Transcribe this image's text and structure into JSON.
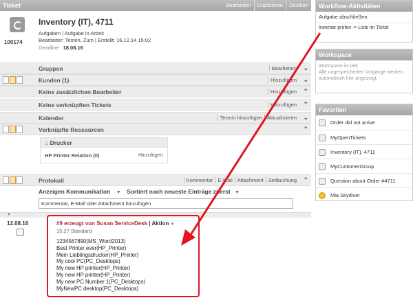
{
  "ticket": {
    "header": "Ticket",
    "actions": [
      "Bearbeiten",
      "Duplizieren",
      "Drucken"
    ],
    "number": "100174",
    "title": "Inventory (IT), 4711",
    "subtitle": "Aufgaben | Aufgabe in Arbeit",
    "bearbeiter": "Bearbeiter: Testen, Zum | Erstellt: 16.12.14 15:02",
    "deadline_label": "Deadline",
    "deadline_value": "18.08.16"
  },
  "sections": {
    "gruppen": {
      "label": "Gruppen",
      "action": "Bearbeiten"
    },
    "kunden": {
      "label": "Kunden (1)",
      "action": "Hinzufügen"
    },
    "bearbeiter": {
      "label": "Keine zusätzlichen Bearbeiter",
      "action": "Hinzufügen"
    },
    "tickets": {
      "label": "Keine verknüpften Tickets",
      "action": "Hinzufügen"
    },
    "kalender": {
      "label": "Kalender",
      "actions": [
        "Termin hinzufügen",
        "Aktualisieren"
      ]
    },
    "ressourcen": {
      "label": "Verknüpfte Ressourcen"
    }
  },
  "drucker": {
    "header": "Drucker",
    "relation": "HP Printer Relation (0)",
    "action": "Hinzufügen"
  },
  "protokoll": {
    "label": "Protokoll",
    "actions": [
      "Kommentar",
      "E-Mail",
      "Attachment",
      "Zeitbuchung"
    ],
    "filter1": "Anzeigen Kommunikation",
    "filter2": "Sortiert nach neueste Einträge zuerst",
    "input_placeholder": "Kommentar, E-Mail oder Attachment hinzufügen"
  },
  "entry": {
    "date": "12.08.16",
    "title": "#9 erzeugt von Susan ServiceDesk",
    "action_label": "Aktion",
    "time": "15:27",
    "type": "Standard",
    "lines": [
      "1234567890(MS_Word2013)",
      "Best Printer ever(HP_Printer)",
      "Mein Lieblingsdrucker(HP_Printer)",
      "My cool PC(PC_Desktops)",
      "My new HP printer(HP_Printer)",
      "My new HP printer(HP_Printer)",
      "My new PC Number 1(PC_Desktops)",
      "MyNewPC desktop(PC_Desktops)"
    ]
  },
  "workflow": {
    "header": "Workflow-Aktivitäten",
    "items": [
      "Aufgabe abschließen",
      "Inventar prüfen -> Liste im Ticket"
    ]
  },
  "workspace": {
    "header": "Workspace",
    "text": "Workspace ist leer\nAlle ungespeicherten Vorgänge werden automatisch hier angezeigt."
  },
  "favoriten": {
    "header": "Favoriten",
    "items": [
      "Order did not arrive",
      "MyOpenTickets",
      "Inventory (IT), 4711",
      "MyCustomerGroup",
      "Question about Order #4711",
      "Mia Skydiver"
    ]
  }
}
